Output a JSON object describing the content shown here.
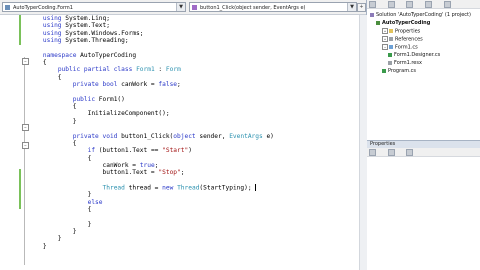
{
  "editor": {
    "class_combo": "AutoTyperCoding.Form1",
    "member_combo": "button1_Click(object sender, EventArgs e)",
    "lines": [
      [
        {
          "t": "    "
        },
        {
          "t": "using",
          "c": "kw"
        },
        {
          "t": " System.Linq;"
        }
      ],
      [
        {
          "t": "    "
        },
        {
          "t": "using",
          "c": "kw"
        },
        {
          "t": " System.Text;"
        }
      ],
      [
        {
          "t": "    "
        },
        {
          "t": "using",
          "c": "kw"
        },
        {
          "t": " System.Windows.Forms;"
        }
      ],
      [
        {
          "t": "    "
        },
        {
          "t": "using",
          "c": "kw"
        },
        {
          "t": " System.Threading;"
        }
      ],
      [
        {
          "t": ""
        }
      ],
      [
        {
          "t": "    "
        },
        {
          "t": "namespace",
          "c": "kw"
        },
        {
          "t": " AutoTyperCoding"
        }
      ],
      [
        {
          "t": "    {"
        }
      ],
      [
        {
          "t": "        "
        },
        {
          "t": "public partial class",
          "c": "kw"
        },
        {
          "t": " "
        },
        {
          "t": "Form1",
          "c": "ty"
        },
        {
          "t": " : "
        },
        {
          "t": "Form",
          "c": "ty"
        }
      ],
      [
        {
          "t": "        {"
        }
      ],
      [
        {
          "t": "            "
        },
        {
          "t": "private bool",
          "c": "kw"
        },
        {
          "t": " canWork = "
        },
        {
          "t": "false",
          "c": "kw"
        },
        {
          "t": ";"
        }
      ],
      [
        {
          "t": ""
        }
      ],
      [
        {
          "t": "            "
        },
        {
          "t": "public",
          "c": "kw"
        },
        {
          "t": " Form1()"
        }
      ],
      [
        {
          "t": "            {"
        }
      ],
      [
        {
          "t": "                InitializeComponent();"
        }
      ],
      [
        {
          "t": "            }"
        }
      ],
      [
        {
          "t": ""
        }
      ],
      [
        {
          "t": "            "
        },
        {
          "t": "private void",
          "c": "kw"
        },
        {
          "t": " button1_Click("
        },
        {
          "t": "object",
          "c": "kw"
        },
        {
          "t": " sender, "
        },
        {
          "t": "EventArgs",
          "c": "ty"
        },
        {
          "t": " e)"
        }
      ],
      [
        {
          "t": "            {"
        }
      ],
      [
        {
          "t": "                "
        },
        {
          "t": "if",
          "c": "kw"
        },
        {
          "t": " (button1.Text == "
        },
        {
          "t": "\"Start\"",
          "c": "st"
        },
        {
          "t": ")"
        }
      ],
      [
        {
          "t": "                {"
        }
      ],
      [
        {
          "t": "                    canWork = "
        },
        {
          "t": "true",
          "c": "kw"
        },
        {
          "t": ";"
        }
      ],
      [
        {
          "t": "                    button1.Text = "
        },
        {
          "t": "\"Stop\"",
          "c": "st"
        },
        {
          "t": ";"
        }
      ],
      [
        {
          "t": ""
        }
      ],
      [
        {
          "t": "                    "
        },
        {
          "t": "Thread",
          "c": "ty"
        },
        {
          "t": " thread = "
        },
        {
          "t": "new",
          "c": "kw"
        },
        {
          "t": " "
        },
        {
          "t": "Thread",
          "c": "ty"
        },
        {
          "t": "(StartTyping); "
        }
      ],
      [
        {
          "t": "                }"
        }
      ],
      [
        {
          "t": "                "
        },
        {
          "t": "else",
          "c": "kw"
        }
      ],
      [
        {
          "t": "                {"
        }
      ],
      [
        {
          "t": ""
        }
      ],
      [
        {
          "t": "                }"
        }
      ],
      [
        {
          "t": "            }"
        }
      ],
      [
        {
          "t": "        }"
        }
      ],
      [
        {
          "t": "    }"
        }
      ]
    ]
  },
  "solution_explorer": {
    "title": "",
    "items": [
      {
        "label": "Solution 'AutoTyperCoding' (1 project)",
        "icon": "solution-icon",
        "level": 0
      },
      {
        "label": "AutoTyperCoding",
        "icon": "csharp-project-icon",
        "level": 1,
        "bold": true
      },
      {
        "label": "Properties",
        "icon": "folder-icon",
        "level": 2
      },
      {
        "label": "References",
        "icon": "references-icon",
        "level": 2
      },
      {
        "label": "Form1.cs",
        "icon": "form-icon",
        "level": 2
      },
      {
        "label": "Form1.Designer.cs",
        "icon": "cs-file-icon",
        "level": 3
      },
      {
        "label": "Form1.resx",
        "icon": "resx-file-icon",
        "level": 3
      },
      {
        "label": "Program.cs",
        "icon": "cs-file-icon",
        "level": 2
      }
    ]
  },
  "properties": {
    "title": "Properties"
  }
}
